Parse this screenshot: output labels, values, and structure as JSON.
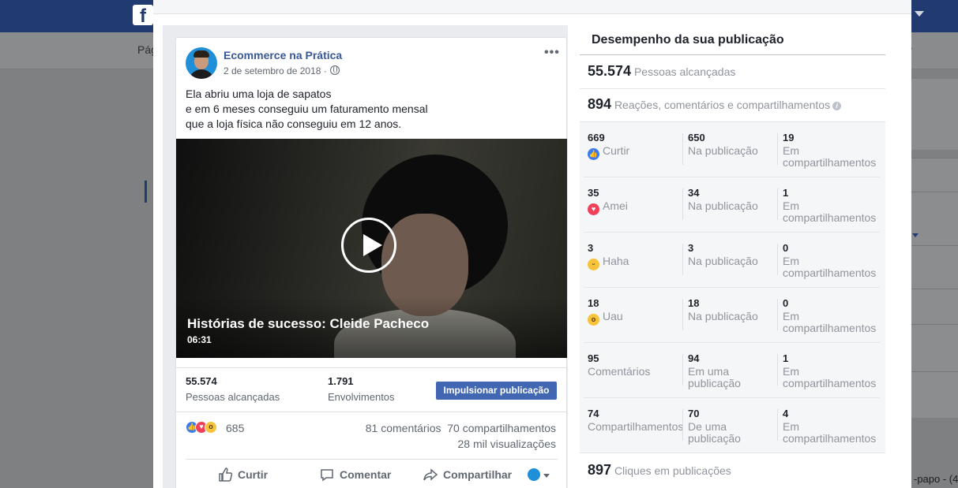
{
  "background": {
    "subnav_label": "Pág",
    "bottom_right_text": "-papo - (4"
  },
  "post": {
    "page_name": "Ecommerce na Prática",
    "date": "2 de setembro de 2018 · ",
    "text_lines": [
      "Ela abriu uma loja de sapatos",
      "e em 6 meses conseguiu um faturamento mensal",
      "que a loja física não conseguiu em 12 anos."
    ],
    "video": {
      "title": "Histórias de sucesso: Cleide Pacheco",
      "duration": "06:31"
    },
    "reach_value": "55.574",
    "reach_label": "Pessoas alcançadas",
    "engagement_value": "1.791",
    "engagement_label": "Envolvimentos",
    "boost_label": "Impulsionar publicação",
    "reaction_count": "685",
    "comments_shares": "81 comentários  70 compartilhamentos",
    "views": "28 mil visualizações",
    "actions": {
      "like": "Curtir",
      "comment": "Comentar",
      "share": "Compartilhar"
    }
  },
  "performance": {
    "title": "Desempenho da sua publicação",
    "reach_value": "55.574",
    "reach_label": "Pessoas alcançadas",
    "engagement_value": "894",
    "engagement_label": "Reações, comentários e compartilhamentos",
    "rows": [
      {
        "total": "669",
        "label": "Curtir",
        "icon": "like-icon",
        "on_post": "650",
        "on_post_label": "Na publicação",
        "on_shares": "19",
        "on_shares_label": "Em compartilhamentos"
      },
      {
        "total": "35",
        "label": "Amei",
        "icon": "love-icon",
        "on_post": "34",
        "on_post_label": "Na publicação",
        "on_shares": "1",
        "on_shares_label": "Em compartilhamentos"
      },
      {
        "total": "3",
        "label": "Haha",
        "icon": "haha-icon",
        "on_post": "3",
        "on_post_label": "Na publicação",
        "on_shares": "0",
        "on_shares_label": "Em compartilhamentos"
      },
      {
        "total": "18",
        "label": "Uau",
        "icon": "wow-icon",
        "on_post": "18",
        "on_post_label": "Na publicação",
        "on_shares": "0",
        "on_shares_label": "Em compartilhamentos"
      },
      {
        "total": "95",
        "label": "Comentários",
        "icon": "",
        "on_post": "94",
        "on_post_label": "Em uma publicação",
        "on_shares": "1",
        "on_shares_label": "Em compartilhamentos"
      },
      {
        "total": "74",
        "label": "Compartilhamentos",
        "icon": "",
        "on_post": "70",
        "on_post_label": "De uma publicação",
        "on_shares": "4",
        "on_shares_label": "Em compartilhamentos"
      }
    ],
    "clicks_value": "897",
    "clicks_label": "Cliques em publicações"
  },
  "colors": {
    "brand_blue": "#4267b2",
    "link_blue": "#385898",
    "muted": "#90949c"
  }
}
